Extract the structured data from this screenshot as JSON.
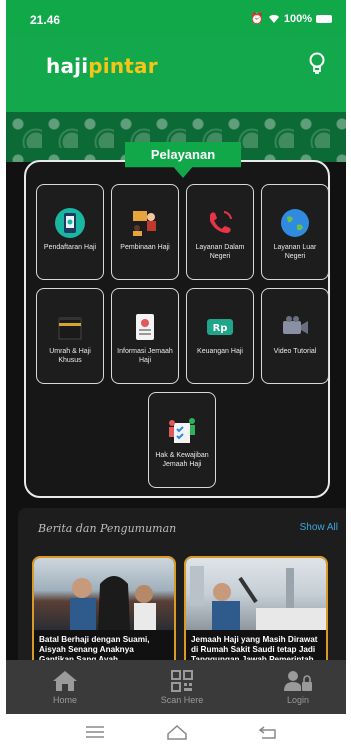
{
  "status_bar": {
    "time": "21.46",
    "signal": "....",
    "battery": "100%"
  },
  "header": {
    "logo_part1": "haji",
    "logo_part2": "pintar"
  },
  "services": {
    "banner": "Pelayanan",
    "tiles": [
      {
        "label": "Pendaftaran Haji",
        "icon": "phone-registration-icon"
      },
      {
        "label": "Pembinaan Haji",
        "icon": "training-class-icon"
      },
      {
        "label": "Layanan Dalam Negeri",
        "icon": "telephone-icon"
      },
      {
        "label": "Layanan Luar Negeri",
        "icon": "globe-icon"
      },
      {
        "label": "Umrah & Haji Khusus",
        "icon": "kaaba-icon"
      },
      {
        "label": "Informasi Jemaah Haji",
        "icon": "id-card-icon"
      },
      {
        "label": "Keuangan Haji",
        "icon": "rupiah-icon"
      },
      {
        "label": "Video Tutorial",
        "icon": "video-camera-icon"
      },
      {
        "label": "Hak & Kewajiban Jemaah Haji",
        "icon": "rights-checklist-icon"
      }
    ]
  },
  "news": {
    "title": "Berita dan Pengumuman",
    "show_all": "Show All",
    "cards": [
      {
        "caption": "Batal Berhaji dengan Suami, Aisyah Senang Anaknya Gantikan Sang Ayah"
      },
      {
        "caption": "Jemaah Haji yang Masih Dirawat di Rumah Sakit Saudi tetap Jadi Tanggungan Jawab Pemerintah"
      }
    ]
  },
  "bottom_nav": [
    {
      "label": "Home",
      "icon": "home-icon"
    },
    {
      "label": "Scan Here",
      "icon": "qr-code-icon"
    },
    {
      "label": "Login",
      "icon": "user-lock-icon"
    }
  ],
  "colors": {
    "brand_green": "#13a84b",
    "accent_yellow": "#f5c518",
    "card_border": "#d99b25",
    "link_blue": "#3ba8df"
  }
}
